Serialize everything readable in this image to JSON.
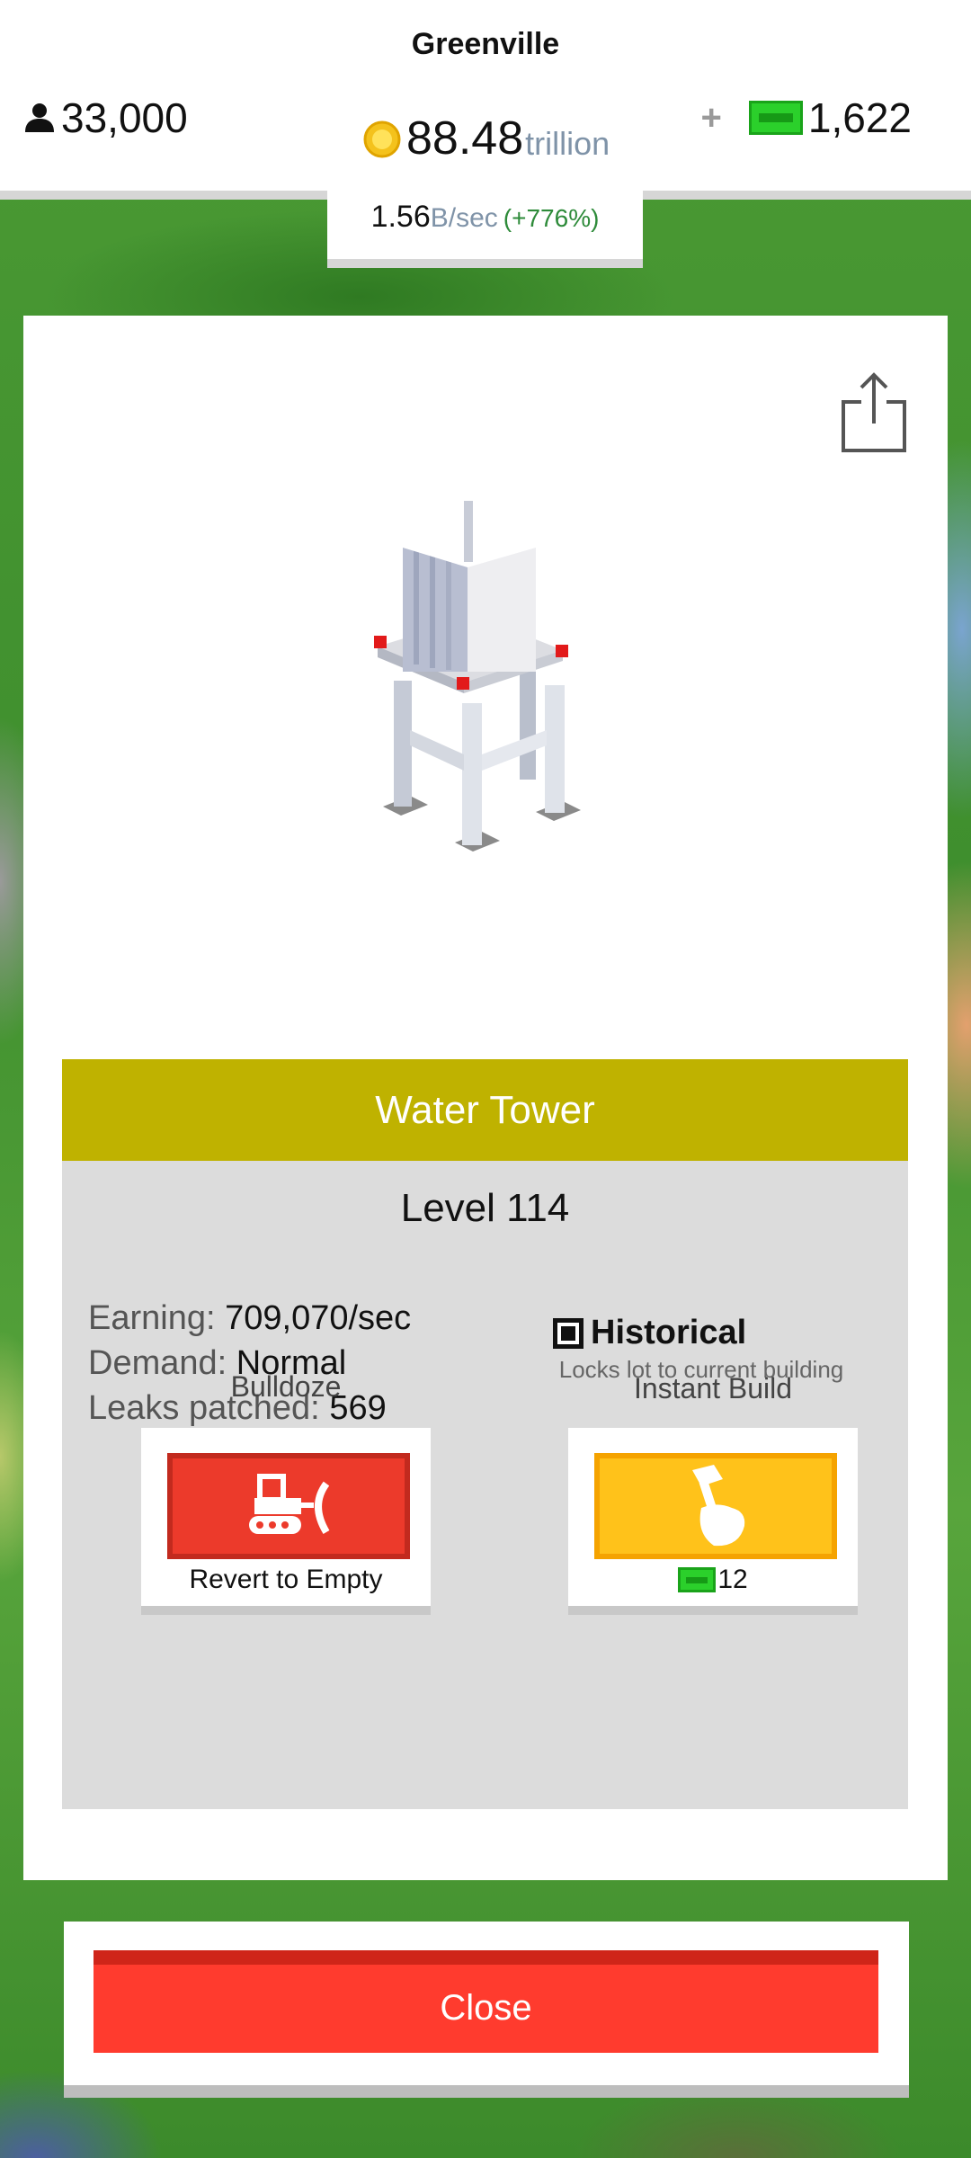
{
  "header": {
    "city_name": "Greenville",
    "population": "33,000",
    "coins_value": "88.48",
    "coins_unit": "trillion",
    "plus": "+",
    "cash": "1,622"
  },
  "income": {
    "value": "1.56",
    "unit": "B/sec",
    "change": "(+776%)"
  },
  "building": {
    "name": "Water Tower",
    "level": "Level 114",
    "banner_color": "#bfb200",
    "stats": [
      {
        "label": "Earning:",
        "value": "709,070/sec"
      },
      {
        "label": "Demand:",
        "value": "Normal"
      },
      {
        "label": "Leaks patched:",
        "value": "569"
      }
    ],
    "historical": {
      "title": "Historical",
      "description": "Locks lot to current building",
      "checked": true
    }
  },
  "actions": {
    "bulldoze": {
      "label": "Bulldoze",
      "caption": "Revert to Empty",
      "icon": "bulldozer-icon"
    },
    "instant_build": {
      "label": "Instant Build",
      "cost": "12",
      "icon": "hammer-hand-icon"
    }
  },
  "close_button": {
    "label": "Close"
  },
  "colors": {
    "red_button": "#ff3b2e",
    "yellow_button": "#ffc21a",
    "cash_green": "#2bd02b"
  }
}
